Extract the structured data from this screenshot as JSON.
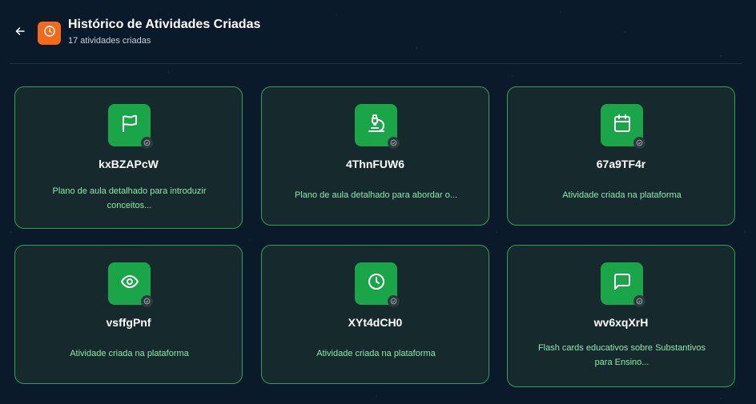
{
  "header": {
    "title": "Histórico de Atividades Criadas",
    "subtitle": "17 atividades criadas",
    "back_icon": "arrow-left-icon",
    "app_icon": "clock-icon",
    "app_icon_color": "#f26b1d"
  },
  "colors": {
    "background": "#0a1a2b",
    "card_background": "#16292c",
    "card_border": "#2fa24f",
    "icon_background": "#1aa549",
    "description_text": "#8ce9a8"
  },
  "cards": [
    {
      "id": "kxBZAPcW",
      "icon": "flag-icon",
      "description": "Plano de aula detalhado para introduzir conceitos..."
    },
    {
      "id": "4ThnFUW6",
      "icon": "microscope-icon",
      "description": "Plano de aula detalhado para abordar o..."
    },
    {
      "id": "67a9TF4r",
      "icon": "calendar-icon",
      "description": "Atividade criada na plataforma"
    },
    {
      "id": "vsffgPnf",
      "icon": "eye-icon",
      "description": "Atividade criada na plataforma"
    },
    {
      "id": "XYt4dCH0",
      "icon": "clock-icon",
      "description": "Atividade criada na plataforma"
    },
    {
      "id": "wv6xqXrH",
      "icon": "message-square-icon",
      "description": "Flash cards educativos sobre Substantivos para Ensino..."
    }
  ]
}
